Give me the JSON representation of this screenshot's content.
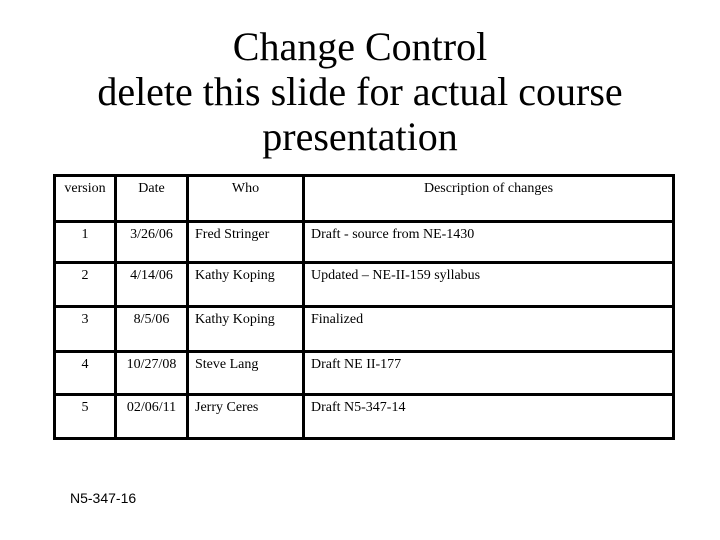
{
  "slide": {
    "title_lines": [
      "Change Control",
      "delete this slide for actual course",
      "presentation"
    ],
    "table": {
      "headers": [
        "version",
        "Date",
        "Who",
        "Description of changes"
      ],
      "rows": [
        [
          "1",
          "3/26/06",
          "Fred Stringer",
          "Draft - source from NE-1430"
        ],
        [
          "2",
          "4/14/06",
          "Kathy Koping",
          "Updated – NE-II-159 syllabus"
        ],
        [
          "3",
          "8/5/06",
          "Kathy Koping",
          "Finalized"
        ],
        [
          "4",
          "10/27/08",
          "Steve Lang",
          "Draft NE II-177"
        ],
        [
          "5",
          "02/06/11",
          "Jerry Ceres",
          "Draft N5-347-14"
        ]
      ]
    },
    "footer": "N5-347-16"
  }
}
